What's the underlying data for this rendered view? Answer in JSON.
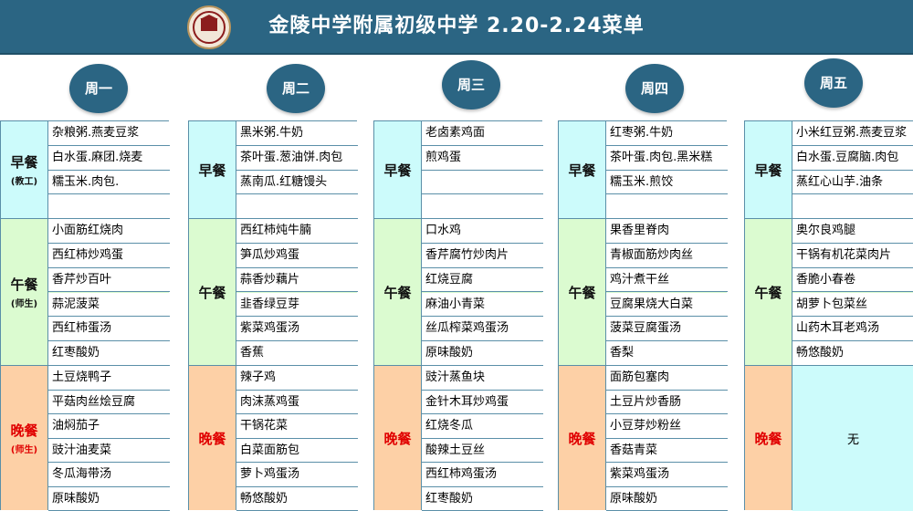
{
  "header": {
    "title": "金陵中学附属初级中学 2.20-2.24菜单",
    "logo_icon": "school-emblem-icon"
  },
  "colors": {
    "header_bg": "#2b6583",
    "breakfast_bg": "#ccfbfb",
    "lunch_bg": "#dbfbd0",
    "dinner_bg": "#fdd0a6",
    "dinner_label": "#e00000"
  },
  "days": [
    {
      "name": "周一",
      "breakfast": {
        "label": "早餐",
        "sub": "(教工)",
        "items": [
          "杂粮粥.燕麦豆浆",
          "白水蛋.麻团.烧麦",
          "糯玉米.肉包.",
          ""
        ]
      },
      "lunch": {
        "label": "午餐",
        "sub": "(师生)",
        "items": [
          "小面筋红烧肉",
          "西红柿炒鸡蛋",
          "香芹炒百叶",
          "蒜泥菠菜",
          "西红柿蛋汤",
          "红枣酸奶"
        ]
      },
      "dinner": {
        "label": "晚餐",
        "sub": "(师生)",
        "items": [
          "土豆烧鸭子",
          "平菇肉丝烩豆腐",
          "油焖茄子",
          "豉汁油麦菜",
          "冬瓜海带汤",
          "原味酸奶"
        ]
      }
    },
    {
      "name": "周二",
      "breakfast": {
        "label": "早餐",
        "sub": "",
        "items": [
          "黑米粥.牛奶",
          "茶叶蛋.葱油饼.肉包",
          "蒸南瓜.红糖馒头",
          ""
        ]
      },
      "lunch": {
        "label": "午餐",
        "sub": "",
        "items": [
          "西红柿炖牛腩",
          "笋瓜炒鸡蛋",
          "蒜香炒藕片",
          "韭香绿豆芽",
          "紫菜鸡蛋汤",
          "香蕉"
        ]
      },
      "dinner": {
        "label": "晚餐",
        "sub": "",
        "items": [
          "辣子鸡",
          "肉沫蒸鸡蛋",
          "干锅花菜",
          "白菜面筋包",
          "萝卜鸡蛋汤",
          "畅悠酸奶"
        ]
      }
    },
    {
      "name": "周三",
      "breakfast": {
        "label": "早餐",
        "sub": "",
        "items": [
          "老卤素鸡面",
          "煎鸡蛋",
          "",
          ""
        ]
      },
      "lunch": {
        "label": "午餐",
        "sub": "",
        "items": [
          "口水鸡",
          "香芹腐竹炒肉片",
          "红烧豆腐",
          "麻油小青菜",
          "丝瓜榨菜鸡蛋汤",
          "原味酸奶"
        ]
      },
      "dinner": {
        "label": "晚餐",
        "sub": "",
        "items": [
          "豉汁蒸鱼块",
          "金针木耳炒鸡蛋",
          "红烧冬瓜",
          "酸辣土豆丝",
          "西红柿鸡蛋汤",
          "红枣酸奶"
        ]
      }
    },
    {
      "name": "周四",
      "breakfast": {
        "label": "早餐",
        "sub": "",
        "items": [
          "红枣粥.牛奶",
          "茶叶蛋.肉包.黑米糕",
          "糯玉米.煎饺",
          ""
        ]
      },
      "lunch": {
        "label": "午餐",
        "sub": "",
        "items": [
          "果香里脊肉",
          "青椒面筋炒肉丝",
          "鸡汁煮干丝",
          "豆腐果烧大白菜",
          "菠菜豆腐蛋汤",
          "香梨"
        ]
      },
      "dinner": {
        "label": "晚餐",
        "sub": "",
        "items": [
          "面筋包塞肉",
          "土豆片炒香肠",
          "小豆芽炒粉丝",
          "香菇青菜",
          "紫菜鸡蛋汤",
          "原味酸奶"
        ]
      }
    },
    {
      "name": "周五",
      "breakfast": {
        "label": "早餐",
        "sub": "",
        "items": [
          "小米红豆粥.燕麦豆浆",
          "白水蛋.豆腐脑.肉包",
          "蒸红心山芋.油条",
          ""
        ]
      },
      "lunch": {
        "label": "午餐",
        "sub": "",
        "items": [
          "奥尔良鸡腿",
          "干锅有机花菜肉片",
          "香脆小春卷",
          "胡萝卜包菜丝",
          "山药木耳老鸡汤",
          "畅悠酸奶"
        ]
      },
      "dinner": {
        "label": "晚餐",
        "sub": "",
        "items": [],
        "none_text": "无"
      }
    }
  ]
}
